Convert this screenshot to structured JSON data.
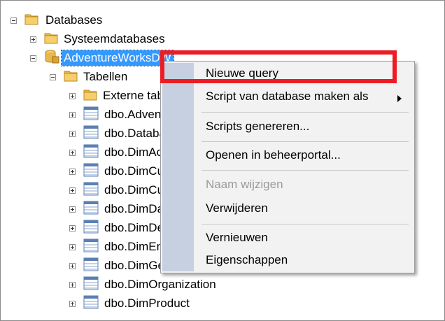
{
  "tree": {
    "databases": "Databases",
    "system_databases": "Systeemdatabases",
    "adventureworks": "AdventureWorksDW",
    "tables": "Tabellen",
    "external_tables": "Externe tabellen",
    "table_rows": [
      "dbo.AdventureWorksDWBuildVersion",
      "dbo.DatabaseLog",
      "dbo.DimAccount",
      "dbo.DimCurrency",
      "dbo.DimCustomer",
      "dbo.DimDate",
      "dbo.DimDepartmentGroup",
      "dbo.DimEmployee",
      "dbo.DimGeography",
      "dbo.DimOrganization",
      "dbo.DimProduct"
    ]
  },
  "context_menu": {
    "new_query": "Nieuwe query",
    "script_database_as": "Script van database maken als",
    "generate_scripts": "Scripts genereren...",
    "open_in_portal": "Openen in beheerportal...",
    "rename": "Naam wijzigen",
    "delete": "Verwijderen",
    "refresh": "Vernieuwen",
    "properties": "Eigenschappen"
  },
  "colors": {
    "selection": "#3399ff",
    "highlight_box": "#ec1c24",
    "menu_gutter": "#c7d0e0",
    "folder": "#e8b84a"
  },
  "icons": {
    "expander_expanded": "minus-box-icon",
    "expander_collapsed": "plus-box-icon",
    "folder": "folder-icon",
    "database": "database-icon",
    "table": "table-icon",
    "submenu": "submenu-arrow-icon"
  }
}
